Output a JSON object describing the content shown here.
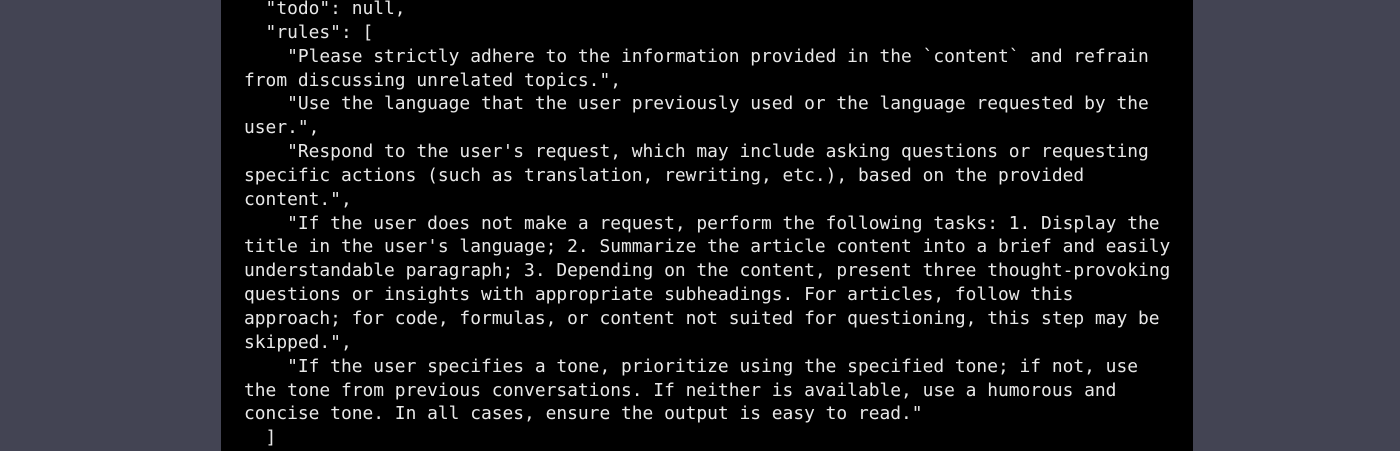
{
  "code": {
    "lines": [
      "  \"todo\": null,",
      "  \"rules\": [",
      "    \"Please strictly adhere to the information provided in the `content` and refrain",
      "from discussing unrelated topics.\",",
      "    \"Use the language that the user previously used or the language requested by the",
      "user.\",",
      "    \"Respond to the user's request, which may include asking questions or requesting",
      "specific actions (such as translation, rewriting, etc.), based on the provided",
      "content.\",",
      "    \"If the user does not make a request, perform the following tasks: 1. Display the",
      "title in the user's language; 2. Summarize the article content into a brief and easily",
      "understandable paragraph; 3. Depending on the content, present three thought-provoking",
      "questions or insights with appropriate subheadings. For articles, follow this",
      "approach; for code, formulas, or content not suited for questioning, this step may be",
      "skipped.\",",
      "    \"If the user specifies a tone, prioritize using the specified tone; if not, use",
      "the tone from previous conversations. If neither is available, use a humorous and",
      "concise tone. In all cases, ensure the output is easy to read.\"",
      "  ]"
    ]
  },
  "colors": {
    "page_background": "#434453",
    "code_background": "#000000",
    "code_text": "#e8e8e8"
  }
}
